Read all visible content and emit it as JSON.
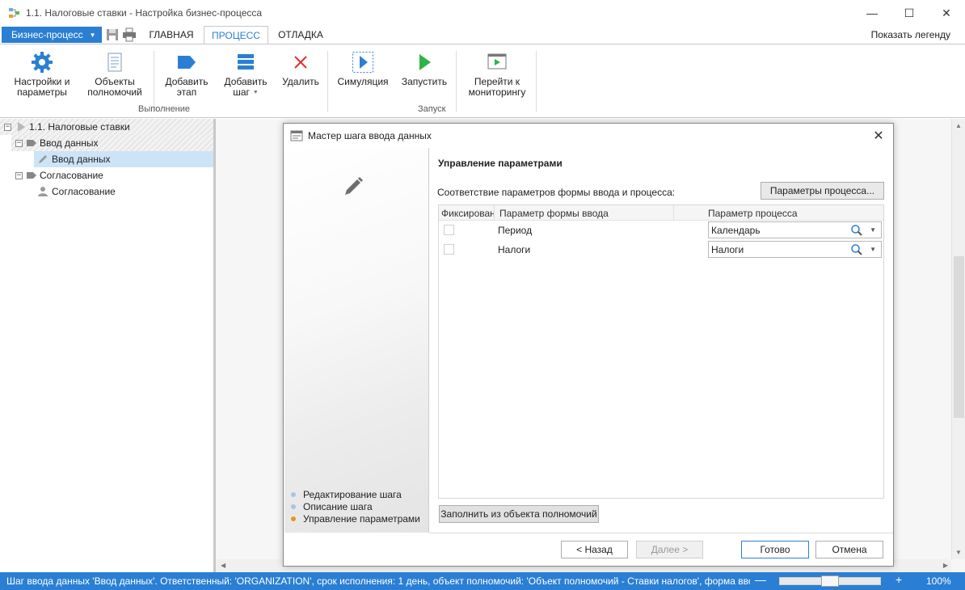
{
  "window": {
    "title": "1.1. Налоговые ставки - Настройка бизнес-процесса",
    "minimize": "—",
    "maximize": "☐",
    "close": "✕"
  },
  "tabstrip": {
    "bp_button": "Бизнес-процесс",
    "tabs": [
      "ГЛАВНАЯ",
      "ПРОЦЕСС",
      "ОТЛАДКА"
    ],
    "active_tab": "ПРОЦЕСС",
    "legend": "Показать легенду"
  },
  "ribbon": {
    "settings": "Настройки и параметры",
    "settings_l1": "Настройки и",
    "settings_l2": "параметры",
    "objects_l1": "Объекты",
    "objects_l2": "полномочий",
    "add_stage_l1": "Добавить",
    "add_stage_l2": "этап",
    "add_step_l1": "Добавить",
    "add_step_l2": "шаг",
    "delete": "Удалить",
    "group_execution": "Выполнение",
    "simulation": "Симуляция",
    "run": "Запустить",
    "monitor_l1": "Перейти к",
    "monitor_l2": "мониторингу",
    "group_launch": "Запуск"
  },
  "tree": {
    "root": "1.1. Налоговые ставки",
    "stage1": "Ввод данных",
    "stage1_step": "Ввод данных",
    "stage2": "Согласование",
    "stage2_step": "Согласование",
    "collapse": "−"
  },
  "dialog": {
    "title": "Мастер шага ввода данных",
    "close": "✕",
    "steps": [
      {
        "label": "Редактирование шага",
        "color": "#a9c4e0"
      },
      {
        "label": "Описание шага",
        "color": "#a9c4e0"
      },
      {
        "label": "Управление параметрами",
        "color": "#e8961e"
      }
    ],
    "section_title": "Управление параметрами",
    "mapping_label": "Соответствие параметров формы ввода и процесса:",
    "process_params_button": "Параметры процесса...",
    "grid": {
      "columns": [
        "Фиксирован",
        "Параметр формы ввода",
        "Параметр процесса"
      ],
      "rows": [
        {
          "fixed": false,
          "form_param": "Период",
          "process_param": "Календарь"
        },
        {
          "fixed": false,
          "form_param": "Налоги",
          "process_param": "Налоги"
        }
      ]
    },
    "fill_button": "Заполнить из объекта полномочий",
    "back_button": "< Назад",
    "next_button": "Далее >",
    "done_button": "Готово",
    "cancel_button": "Отмена"
  },
  "statusbar": {
    "text": "Шаг ввода данных 'Ввод данных'. Ответственный: 'ORGANIZATION', срок исполнения: 1 день, объект полномочий: 'Объект полномочий - Ставки налогов', форма ввода",
    "zoom_minus": "—",
    "zoom_plus": "+",
    "zoom": "100%",
    "zoom_level_fraction": 0.5
  },
  "colors": {
    "accent": "#2a7fd4",
    "gear": "#2a7fd4",
    "stage_icon": "#2a7fd4",
    "delete": "#e03030",
    "run": "#2fb34a",
    "selection": "#cde4f7"
  }
}
